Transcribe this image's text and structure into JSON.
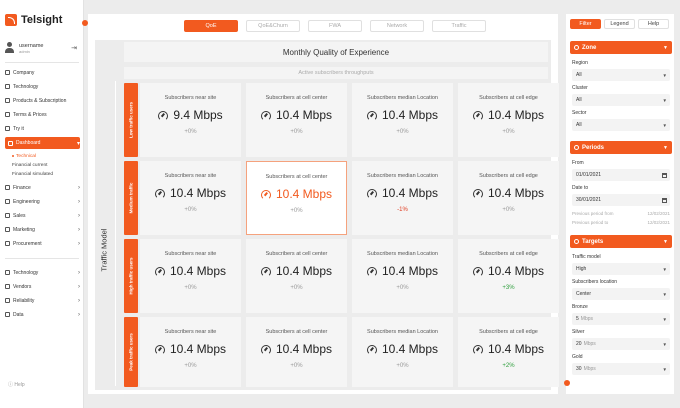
{
  "app": {
    "name": "Telsight"
  },
  "user": {
    "name": "username",
    "role": "admin"
  },
  "nav": {
    "company": "Company",
    "technology": "Technology",
    "products": "Products & Subscription",
    "terms": "Terms & Prices",
    "tryit": "Try it",
    "dashboard": "Dashboard",
    "sub": [
      "Technical",
      "Financial current",
      "Financial simulated"
    ],
    "finance": "Finance",
    "engineering": "Engineering",
    "sales": "Sales",
    "marketing": "Marketing",
    "procurement": "Procurement",
    "technology2": "Technology",
    "vendors": "Vendors",
    "reliability": "Reliability",
    "data": "Data",
    "help": "Help"
  },
  "tabs": [
    "QoE",
    "QoE&Churn",
    "FWA",
    "Network",
    "Traffic"
  ],
  "main": {
    "title": "Monthly Quality of Experience",
    "subtitle": "Active subscribers throughputs",
    "axis_label": "Traffic Model"
  },
  "rows": [
    {
      "label": "Low traffic users",
      "cards": [
        {
          "title": "Subscribers near site",
          "value": "9.4 Mbps",
          "delta": "+0%"
        },
        {
          "title": "Subscribers at cell center",
          "value": "10.4 Mbps",
          "delta": "+0%"
        },
        {
          "title": "Subscribers median Location",
          "value": "10.4 Mbps",
          "delta": "+0%"
        },
        {
          "title": "Subscribers at cell edge",
          "value": "10.4 Mbps",
          "delta": "+0%"
        }
      ]
    },
    {
      "label": "Medium traffic",
      "cards": [
        {
          "title": "Subscribers near site",
          "value": "10.4 Mbps",
          "delta": "+0%"
        },
        {
          "title": "Subscribers at cell center",
          "value": "10.4 Mbps",
          "delta": "+0%"
        },
        {
          "title": "Subscribers median Location",
          "value": "10.4 Mbps",
          "delta": "-1%"
        },
        {
          "title": "Subscribers at cell edge",
          "value": "10.4 Mbps",
          "delta": "+0%"
        }
      ]
    },
    {
      "label": "High traffic users",
      "cards": [
        {
          "title": "Subscribers near site",
          "value": "10.4 Mbps",
          "delta": "+0%"
        },
        {
          "title": "Subscribers at cell center",
          "value": "10.4 Mbps",
          "delta": "+0%"
        },
        {
          "title": "Subscribers median Location",
          "value": "10.4 Mbps",
          "delta": "+0%"
        },
        {
          "title": "Subscribers at cell edge",
          "value": "10.4 Mbps",
          "delta": "+3%"
        }
      ]
    },
    {
      "label": "Peak traffic users",
      "cards": [
        {
          "title": "Subscribers near site",
          "value": "10.4 Mbps",
          "delta": "+0%"
        },
        {
          "title": "Subscribers at cell center",
          "value": "10.4 Mbps",
          "delta": "+0%"
        },
        {
          "title": "Subscribers median Location",
          "value": "10.4 Mbps",
          "delta": "+0%"
        },
        {
          "title": "Subscribers at cell edge",
          "value": "10.4 Mbps",
          "delta": "+2%"
        }
      ]
    }
  ],
  "right": {
    "tabs": [
      "Filter",
      "Legend",
      "Help"
    ],
    "zone": {
      "title": "Zone",
      "region_label": "Region",
      "region": "All",
      "cluster_label": "Cluster",
      "cluster": "All",
      "sector_label": "Sector",
      "sector": "All"
    },
    "periods": {
      "title": "Periods",
      "from_label": "From",
      "from": "01/01/2021",
      "to_label": "Date to",
      "to": "30/01/2021",
      "prev_from_label": "Previous period from",
      "prev_from": "12/02/2021",
      "prev_to_label": "Previous period to",
      "prev_to": "12/02/2021"
    },
    "targets": {
      "title": "Targets",
      "traffic_label": "Traffic model",
      "traffic": "High",
      "loc_label": "Subscribers location",
      "loc": "Center",
      "bronze_label": "Bronze",
      "bronze": "5",
      "silver_label": "Silver",
      "silver": "20",
      "gold_label": "Gold",
      "gold": "30",
      "unit": "Mbps"
    }
  },
  "colors": {
    "accent": "#f25a1f",
    "negative": "#e03a1e",
    "positive": "#2e9e3c"
  }
}
